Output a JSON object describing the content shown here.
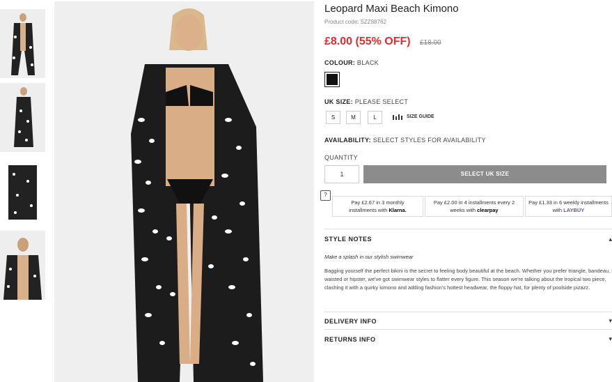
{
  "product": {
    "title": "Leopard Maxi Beach Kimono",
    "code": "Product code: SZZ88762",
    "price": "£8.00 (55% OFF)",
    "was_price": "£18.00"
  },
  "colour": {
    "label": "COLOUR:",
    "value": "BLACK",
    "swatch": "#111111"
  },
  "size": {
    "label": "UK SIZE:",
    "value": "PLEASE SELECT",
    "options": [
      "S",
      "M",
      "L"
    ],
    "guide": "SIZE GUIDE"
  },
  "availability": {
    "label": "AVAILABILITY:",
    "value": "SELECT STYLES FOR AVAILABILITY"
  },
  "quantity": {
    "label": "QUANTITY",
    "value": "1"
  },
  "cta": "SELECT UK SIZE",
  "help": "?",
  "payments": [
    {
      "line1": "Pay £2.67 in 3 monthly",
      "line2": "installments with",
      "brand": "Klarna."
    },
    {
      "line1": "Pay £2.00 in 4 installments every 2",
      "line2": "weeks with",
      "brand": "clearpay"
    },
    {
      "line1": "Pay £1.33 in 6 weekly installments",
      "line2": "with",
      "brand": "LAYBUY"
    }
  ],
  "style_notes": {
    "heading": "STYLE NOTES",
    "tagline": "Make a splash in our stylish swimwear",
    "body": "Bagging yourself the perfect bikini is the secret to feeling body beautiful at the beach. Whether you prefer triangle, bandeau, high waisted or hipster, we've got swimwear styles to flatter every figure. This season we're talking about the tropical two piece, clashing it with a quirky kimono and adding fashion's hottest headwear, the floppy hat, for plenty of poolside pizazz."
  },
  "delivery": {
    "heading": "DELIVERY INFO"
  },
  "returns": {
    "heading": "RETURNS INFO"
  }
}
